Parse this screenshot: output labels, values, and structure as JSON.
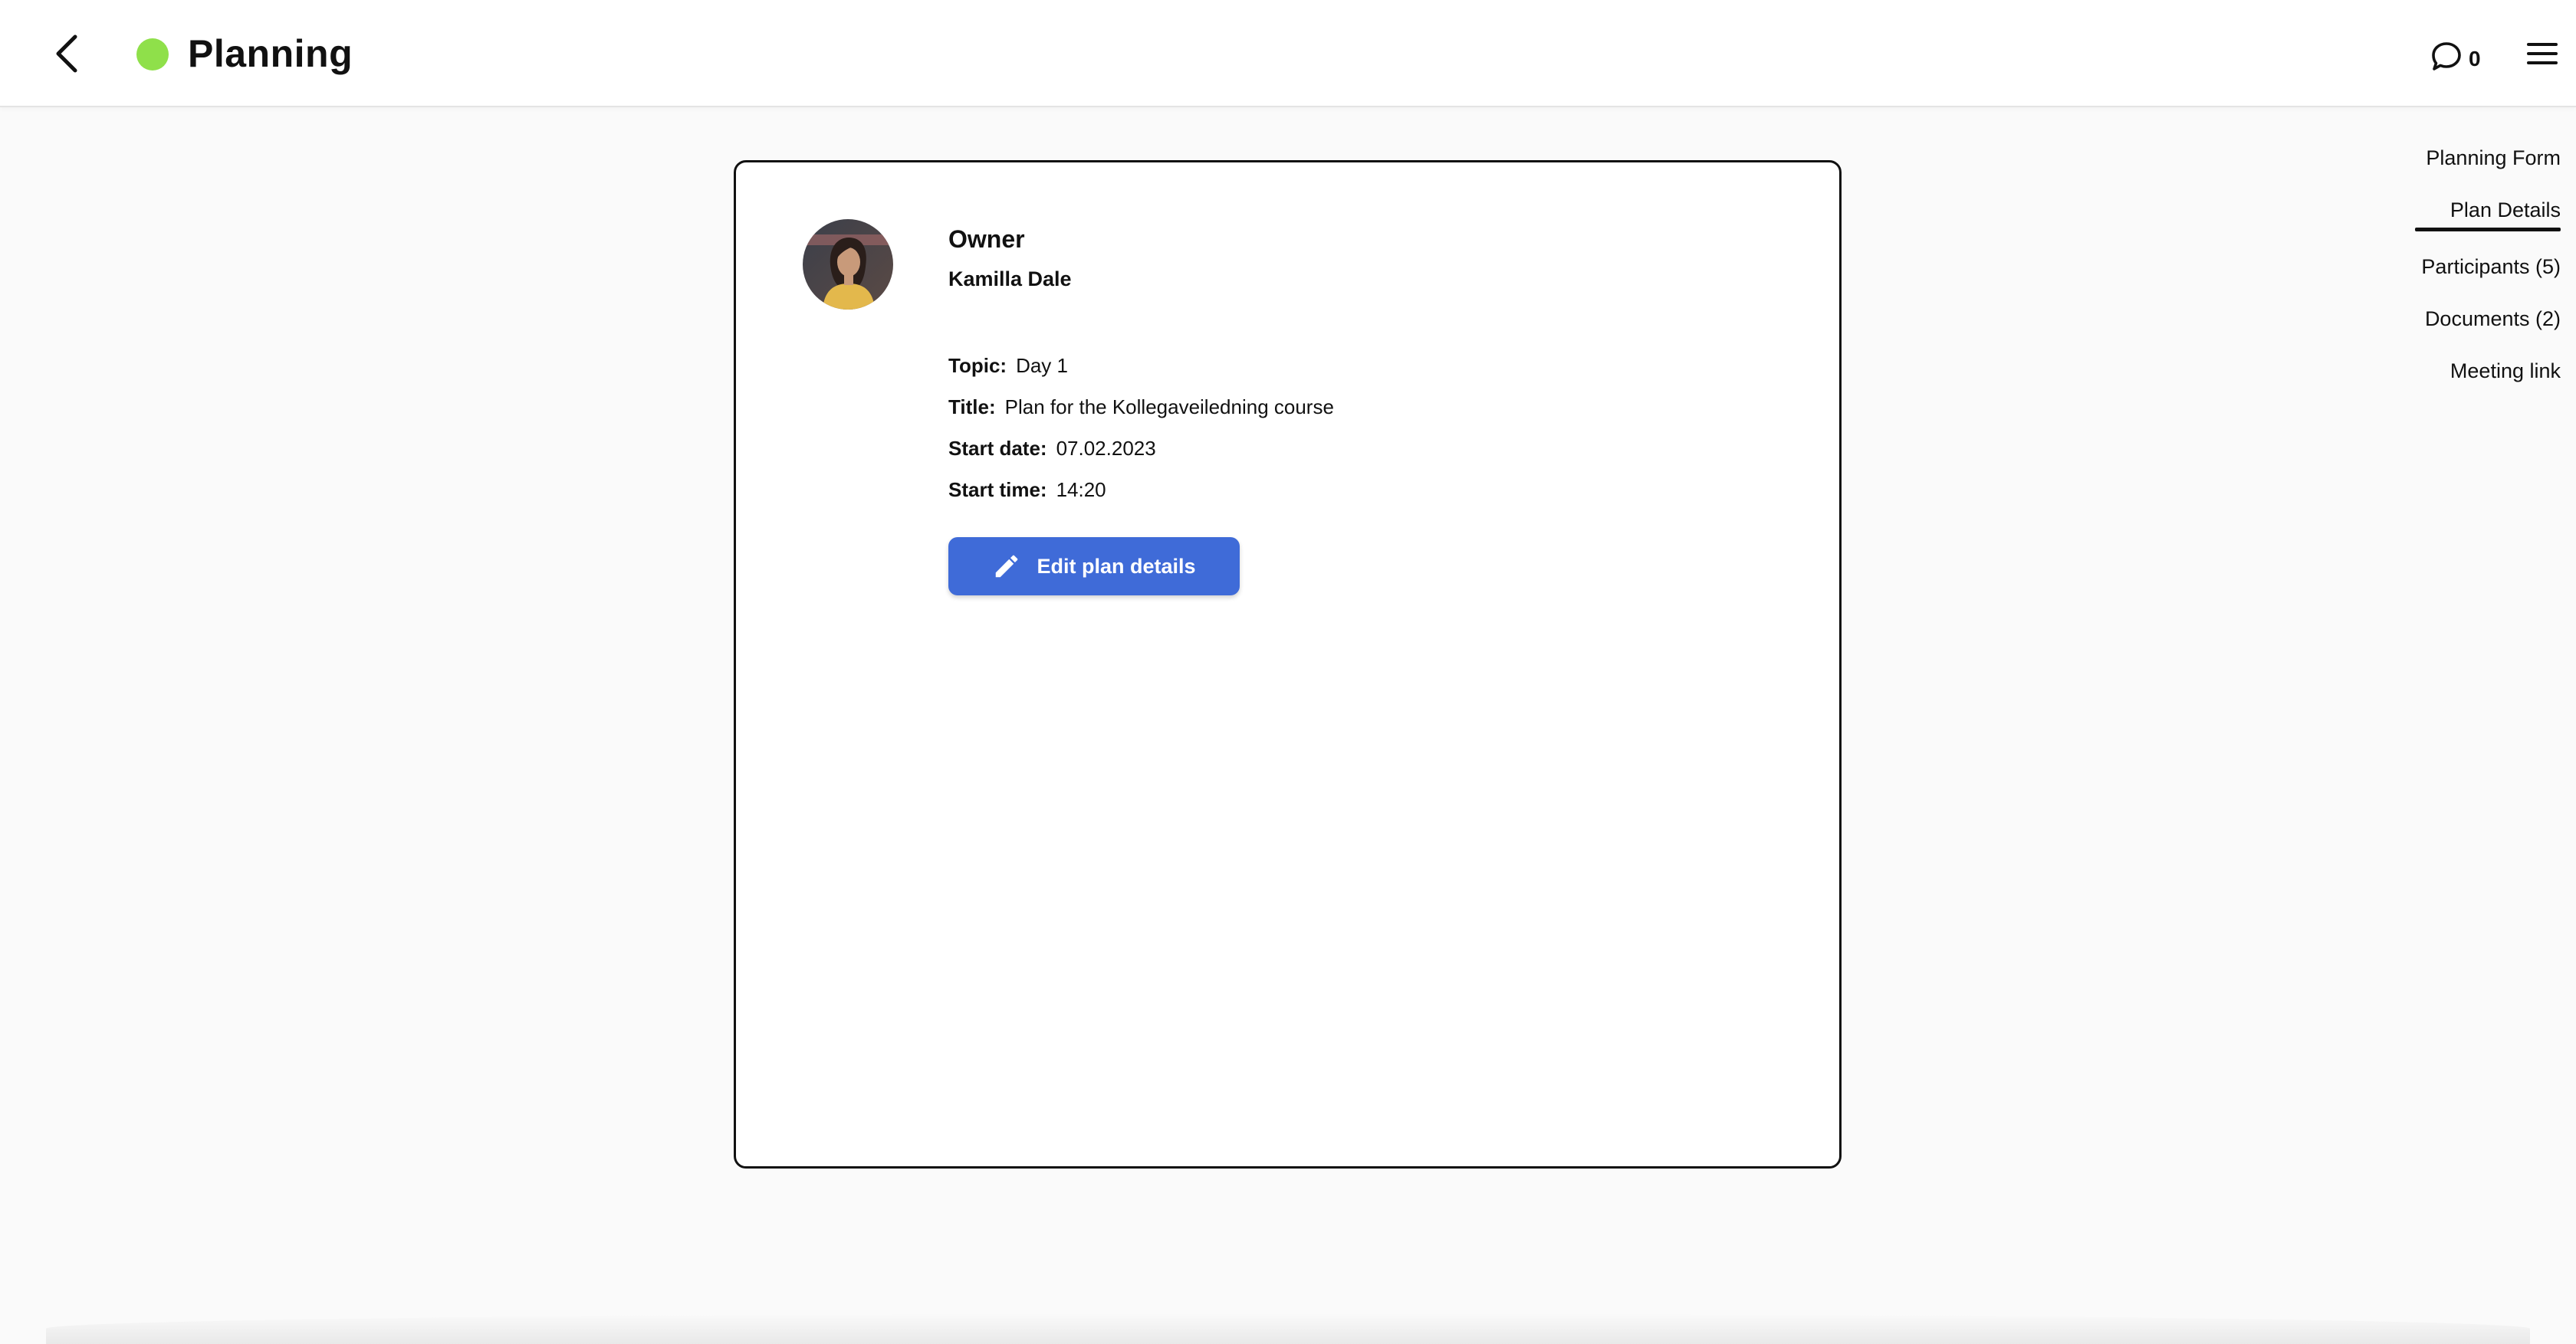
{
  "header": {
    "title": "Planning",
    "status_color": "#8fe04a",
    "back_icon": "chevron-left-icon",
    "comments_icon": "chat-bubble-icon",
    "comments_count": "0",
    "menu_icon": "hamburger-menu-icon"
  },
  "card": {
    "owner_label": "Owner",
    "owner_name": "Kamilla Dale",
    "avatar_alt": "Kamilla Dale",
    "details": [
      {
        "key": "Topic:",
        "value": "Day 1"
      },
      {
        "key": "Title:",
        "value": "Plan for the Kollegaveiledning course"
      },
      {
        "key": "Start date:",
        "value": "07.02.2023"
      },
      {
        "key": "Start time:",
        "value": "14:20"
      }
    ],
    "edit_button_label": "Edit plan details",
    "edit_icon": "pencil-icon",
    "accent_color": "#3f6bd8"
  },
  "side_nav": {
    "items": [
      {
        "label": "Planning Form",
        "active": false
      },
      {
        "label": "Plan Details",
        "active": true
      },
      {
        "label": "Participants (5)",
        "active": false
      },
      {
        "label": "Documents (2)",
        "active": false
      },
      {
        "label": "Meeting link",
        "active": false
      }
    ]
  }
}
